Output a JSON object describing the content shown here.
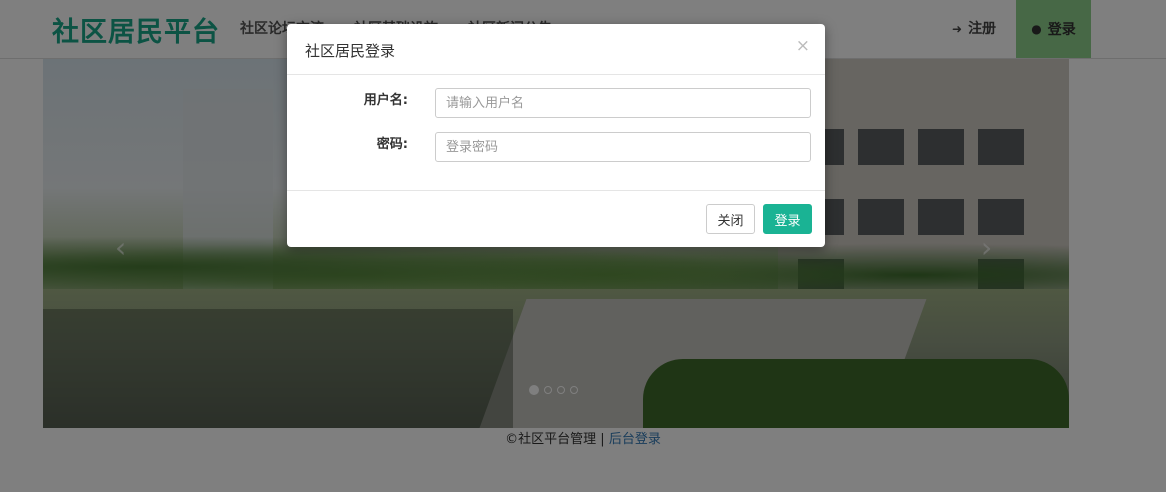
{
  "navbar": {
    "brand": "社区居民平台",
    "links": [
      "社区论坛交流",
      "社区基础设施",
      "社区新闻公告"
    ],
    "register_label": "注册",
    "login_label": "登录"
  },
  "carousel": {
    "prev_glyph": "‹",
    "next_glyph": "›",
    "slide_count": 4,
    "active_slide": 1
  },
  "footer": {
    "copyright": "©社区平台管理 | ",
    "admin_link": "后台登录"
  },
  "modal": {
    "title": "社区居民登录",
    "close_glyph": "×",
    "username_label": "用户名:",
    "username_placeholder": "请输入用户名",
    "password_label": "密码:",
    "password_placeholder": "登录密码",
    "close_button": "关闭",
    "login_button": "登录"
  },
  "colors": {
    "brand": "#18a689",
    "login_nav_bg": "#8fd08d",
    "primary_button": "#1ab394"
  }
}
